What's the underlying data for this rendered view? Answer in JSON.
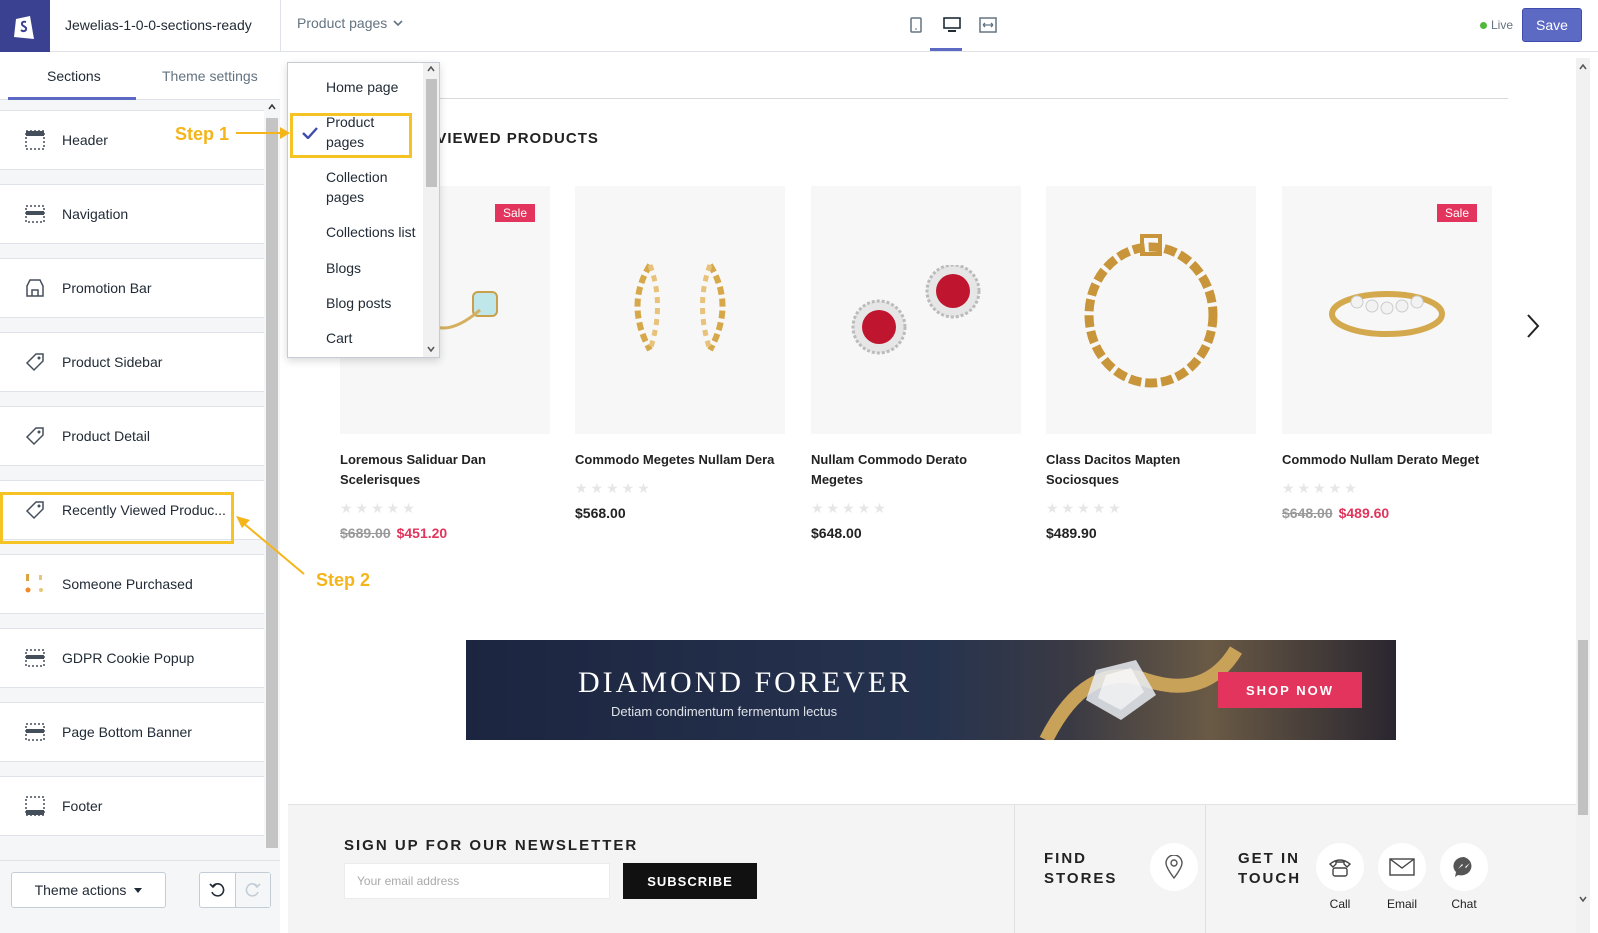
{
  "topbar": {
    "store_name": "Jewelias-1-0-0-sections-ready",
    "page_select": "Product pages",
    "live_label": "Live",
    "save_label": "Save"
  },
  "sidebar": {
    "tabs": [
      "Sections",
      "Theme settings"
    ],
    "sections": [
      {
        "label": "Header",
        "icon": "header-layout-icon"
      },
      {
        "label": "Navigation",
        "icon": "navigation-layout-icon"
      },
      {
        "label": "Promotion Bar",
        "icon": "store-icon"
      },
      {
        "label": "Product Sidebar",
        "icon": "tag-icon"
      },
      {
        "label": "Product Detail",
        "icon": "tag-icon"
      },
      {
        "label": "Recently Viewed Produc...",
        "icon": "tag-icon"
      },
      {
        "label": "Someone Purchased",
        "icon": "product-thumbnail-icon"
      },
      {
        "label": "GDPR Cookie Popup",
        "icon": "layout-icon"
      },
      {
        "label": "Page Bottom Banner",
        "icon": "layout-icon"
      },
      {
        "label": "Footer",
        "icon": "footer-layout-icon"
      }
    ],
    "theme_actions": "Theme actions"
  },
  "dropdown": {
    "items": [
      "Home page",
      "Product pages",
      "Collection pages",
      "Collections list",
      "Blogs",
      "Blog posts",
      "Cart"
    ],
    "selected": "Product pages"
  },
  "annotations": {
    "step1": "Step 1",
    "step2": "Step 2",
    "color": "#f5c324"
  },
  "preview": {
    "section_title": "RECENTLY VIEWED PRODUCTS",
    "products": [
      {
        "name": "Loremous Saliduar Dan Scelerisques",
        "old_price": "$689.00",
        "price": "$451.20",
        "sale": "Sale"
      },
      {
        "name": "Commodo Megetes Nullam Dera",
        "old_price": "",
        "price": "$568.00",
        "sale": ""
      },
      {
        "name": "Nullam Commodo Derato Megetes",
        "old_price": "",
        "price": "$648.00",
        "sale": ""
      },
      {
        "name": "Class Dacitos Mapten Sociosques",
        "old_price": "",
        "price": "$489.90",
        "sale": ""
      },
      {
        "name": "Commodo Nullam Derato Meget",
        "old_price": "$648.00",
        "price": "$489.60",
        "sale": "Sale"
      }
    ],
    "banner": {
      "title": "DIAMOND FOREVER",
      "subtitle": "Detiam condimentum fermentum lectus",
      "button": "SHOP NOW"
    },
    "newsletter": {
      "title": "SIGN UP FOR OUR NEWSLETTER",
      "placeholder": "Your email address",
      "button": "SUBSCRIBE"
    },
    "find_stores": "FIND STORES",
    "get_in_touch": "GET IN TOUCH",
    "contacts": [
      "Call",
      "Email",
      "Chat"
    ]
  },
  "colors": {
    "accent": "#5c6ac4",
    "sale": "#e2345c",
    "highlight": "#f5c324"
  }
}
